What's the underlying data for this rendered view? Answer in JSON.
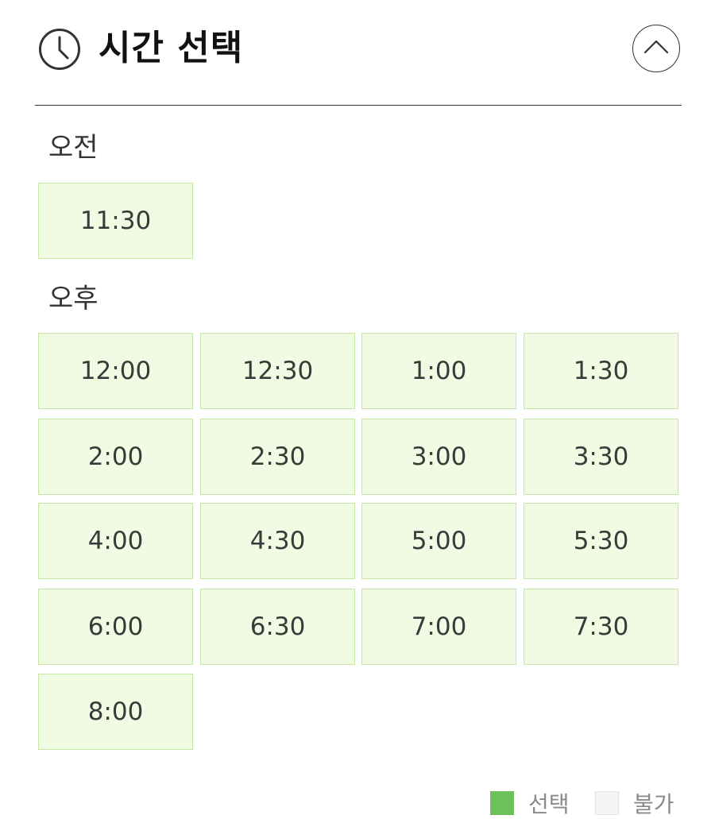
{
  "header": {
    "title": "시간 선택",
    "icon": "clock-icon",
    "collapse_icon": "chevron-up-icon"
  },
  "am": {
    "label": "오전",
    "slots": [
      "11:30"
    ]
  },
  "pm": {
    "label": "오후",
    "slots": [
      "12:00",
      "12:30",
      "1:00",
      "1:30",
      "2:00",
      "2:30",
      "3:00",
      "3:30",
      "4:00",
      "4:30",
      "5:00",
      "5:30",
      "6:00",
      "6:30",
      "7:00",
      "7:30",
      "8:00"
    ]
  },
  "legend": {
    "selected_label": "선택",
    "unavailable_label": "불가"
  },
  "colors": {
    "slot_background": "#f1fbe3",
    "slot_border": "#c5e6a6",
    "selected": "#6cc15b",
    "unavailable": "#f4f5f4"
  }
}
